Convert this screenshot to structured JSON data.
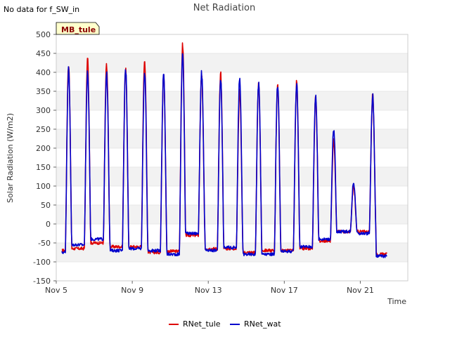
{
  "note": "No data for f_SW_in",
  "chart_data": {
    "type": "line",
    "title": "Net Radiation",
    "badge": "MB_tule",
    "xlabel": "Time",
    "ylabel": "Solar Radiation (W/m2)",
    "ylim": [
      -150,
      500
    ],
    "yticks": [
      -150,
      -100,
      -50,
      0,
      50,
      100,
      150,
      200,
      250,
      300,
      350,
      400,
      450,
      500
    ],
    "xlim": [
      5.0,
      23.5
    ],
    "xticks": [
      {
        "value": 5,
        "label": "Nov 5"
      },
      {
        "value": 9,
        "label": "Nov 9"
      },
      {
        "value": 13,
        "label": "Nov 13"
      },
      {
        "value": 17,
        "label": "Nov 17"
      },
      {
        "value": 21,
        "label": "Nov 21"
      }
    ],
    "grid_bands": true,
    "legend_position": "bottom-center",
    "daily_peaks": [
      {
        "day": 5.65,
        "tule": 420,
        "wat": 410
      },
      {
        "day": 6.65,
        "tule": 430,
        "wat": 400
      },
      {
        "day": 7.65,
        "tule": 420,
        "wat": 395
      },
      {
        "day": 8.65,
        "tule": 410,
        "wat": 410
      },
      {
        "day": 9.65,
        "tule": 432,
        "wat": 400
      },
      {
        "day": 10.65,
        "tule": 393,
        "wat": 393
      },
      {
        "day": 11.65,
        "tule": 472,
        "wat": 452
      },
      {
        "day": 12.65,
        "tule": 390,
        "wat": 397
      },
      {
        "day": 13.65,
        "tule": 395,
        "wat": 385
      },
      {
        "day": 14.65,
        "tule": 350,
        "wat": 385
      },
      {
        "day": 15.65,
        "tule": 370,
        "wat": 372
      },
      {
        "day": 16.65,
        "tule": 368,
        "wat": 370
      },
      {
        "day": 17.65,
        "tule": 372,
        "wat": 372
      },
      {
        "day": 18.65,
        "tule": 330,
        "wat": 340
      },
      {
        "day": 19.6,
        "tule": 225,
        "wat": 250
      },
      {
        "day": 20.65,
        "tule": 95,
        "wat": 110
      },
      {
        "day": 21.65,
        "tule": 335,
        "wat": 340
      }
    ],
    "night_levels": [
      {
        "day": 5.2,
        "tule": -70,
        "wat": -75
      },
      {
        "day": 6.2,
        "tule": -65,
        "wat": -55
      },
      {
        "day": 7.2,
        "tule": -50,
        "wat": -40
      },
      {
        "day": 8.2,
        "tule": -60,
        "wat": -70
      },
      {
        "day": 9.2,
        "tule": -60,
        "wat": -65
      },
      {
        "day": 10.2,
        "tule": -75,
        "wat": -70
      },
      {
        "day": 11.2,
        "tule": -72,
        "wat": -80
      },
      {
        "day": 12.2,
        "tule": -30,
        "wat": -25
      },
      {
        "day": 13.2,
        "tule": -65,
        "wat": -70
      },
      {
        "day": 14.2,
        "tule": -65,
        "wat": -62
      },
      {
        "day": 15.2,
        "tule": -75,
        "wat": -80
      },
      {
        "day": 16.2,
        "tule": -70,
        "wat": -80
      },
      {
        "day": 17.2,
        "tule": -70,
        "wat": -72
      },
      {
        "day": 18.2,
        "tule": -65,
        "wat": -60
      },
      {
        "day": 19.2,
        "tule": -45,
        "wat": -40
      },
      {
        "day": 20.2,
        "tule": -20,
        "wat": -20
      },
      {
        "day": 21.2,
        "tule": -20,
        "wat": -25
      },
      {
        "day": 22.2,
        "tule": -80,
        "wat": -85
      }
    ],
    "series": [
      {
        "name": "RNet_tule",
        "color": "#dd0000"
      },
      {
        "name": "RNet_wat",
        "color": "#0000cc"
      }
    ]
  }
}
